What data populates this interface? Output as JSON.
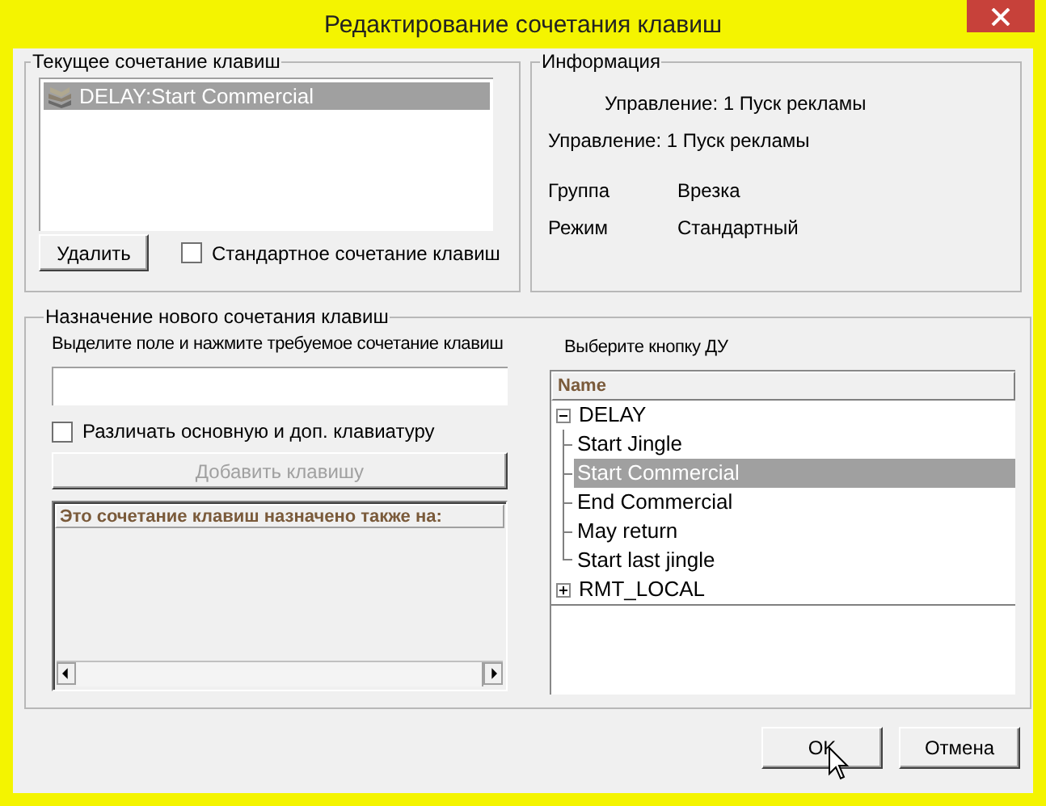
{
  "window": {
    "title": "Редактирование сочетания клавиш"
  },
  "current_shortcut": {
    "legend": "Текущее сочетание клавиш",
    "items": [
      {
        "label": "DELAY:Start Commercial",
        "selected": true
      }
    ],
    "delete_button": "Удалить",
    "standard_checkbox": {
      "label": "Стандартное сочетание клавиш",
      "checked": false
    }
  },
  "info": {
    "legend": "Информация",
    "lines": [
      {
        "text": "Управление: 1 Пуск рекламы",
        "kind": "indented"
      },
      {
        "text": "Управление: 1 Пуск рекламы",
        "kind": "plain"
      }
    ],
    "fields": [
      {
        "label": "Группа",
        "value": "Врезка"
      },
      {
        "label": "Режим",
        "value": "Стандартный"
      }
    ]
  },
  "new_shortcut": {
    "legend": "Назначение нового сочетания клавиш",
    "hint": "Выделите поле и нажмите требуемое сочетание клавиш",
    "distinguish_checkbox": {
      "label": "Различать основную и доп. клавиатуру",
      "checked": false
    },
    "add_button": {
      "label": "Добавить клавишу",
      "disabled": true
    },
    "conflicts": {
      "column": "Это сочетание клавиш назначено также на:"
    },
    "remote_label": "Выберите кнопку ДУ",
    "tree": {
      "column": "Name",
      "nodes": [
        {
          "label": "DELAY",
          "expanded": true,
          "selected": false,
          "children": [
            {
              "label": "Start Jingle",
              "selected": false
            },
            {
              "label": "Start Commercial",
              "selected": true
            },
            {
              "label": "End Commercial",
              "selected": false
            },
            {
              "label": "May return",
              "selected": false
            },
            {
              "label": "Start last jingle",
              "selected": false
            }
          ]
        },
        {
          "label": "RMT_LOCAL",
          "expanded": false,
          "selected": false
        }
      ]
    }
  },
  "buttons": [
    {
      "label": "OK"
    },
    {
      "label": "Отмена"
    }
  ]
}
